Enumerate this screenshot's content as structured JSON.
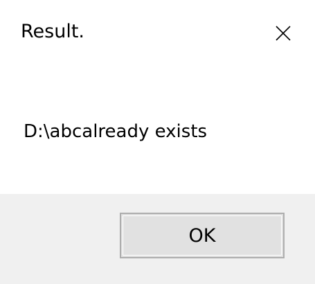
{
  "dialog": {
    "title": "Result.",
    "message": "D:\\abcalready exists",
    "close_icon": "close-icon",
    "ok_label": "OK"
  },
  "colors": {
    "background": "#ffffff",
    "footer": "#f0f0f0",
    "button_face": "#e1e1e1",
    "button_border": "#adadad",
    "text": "#000000"
  }
}
